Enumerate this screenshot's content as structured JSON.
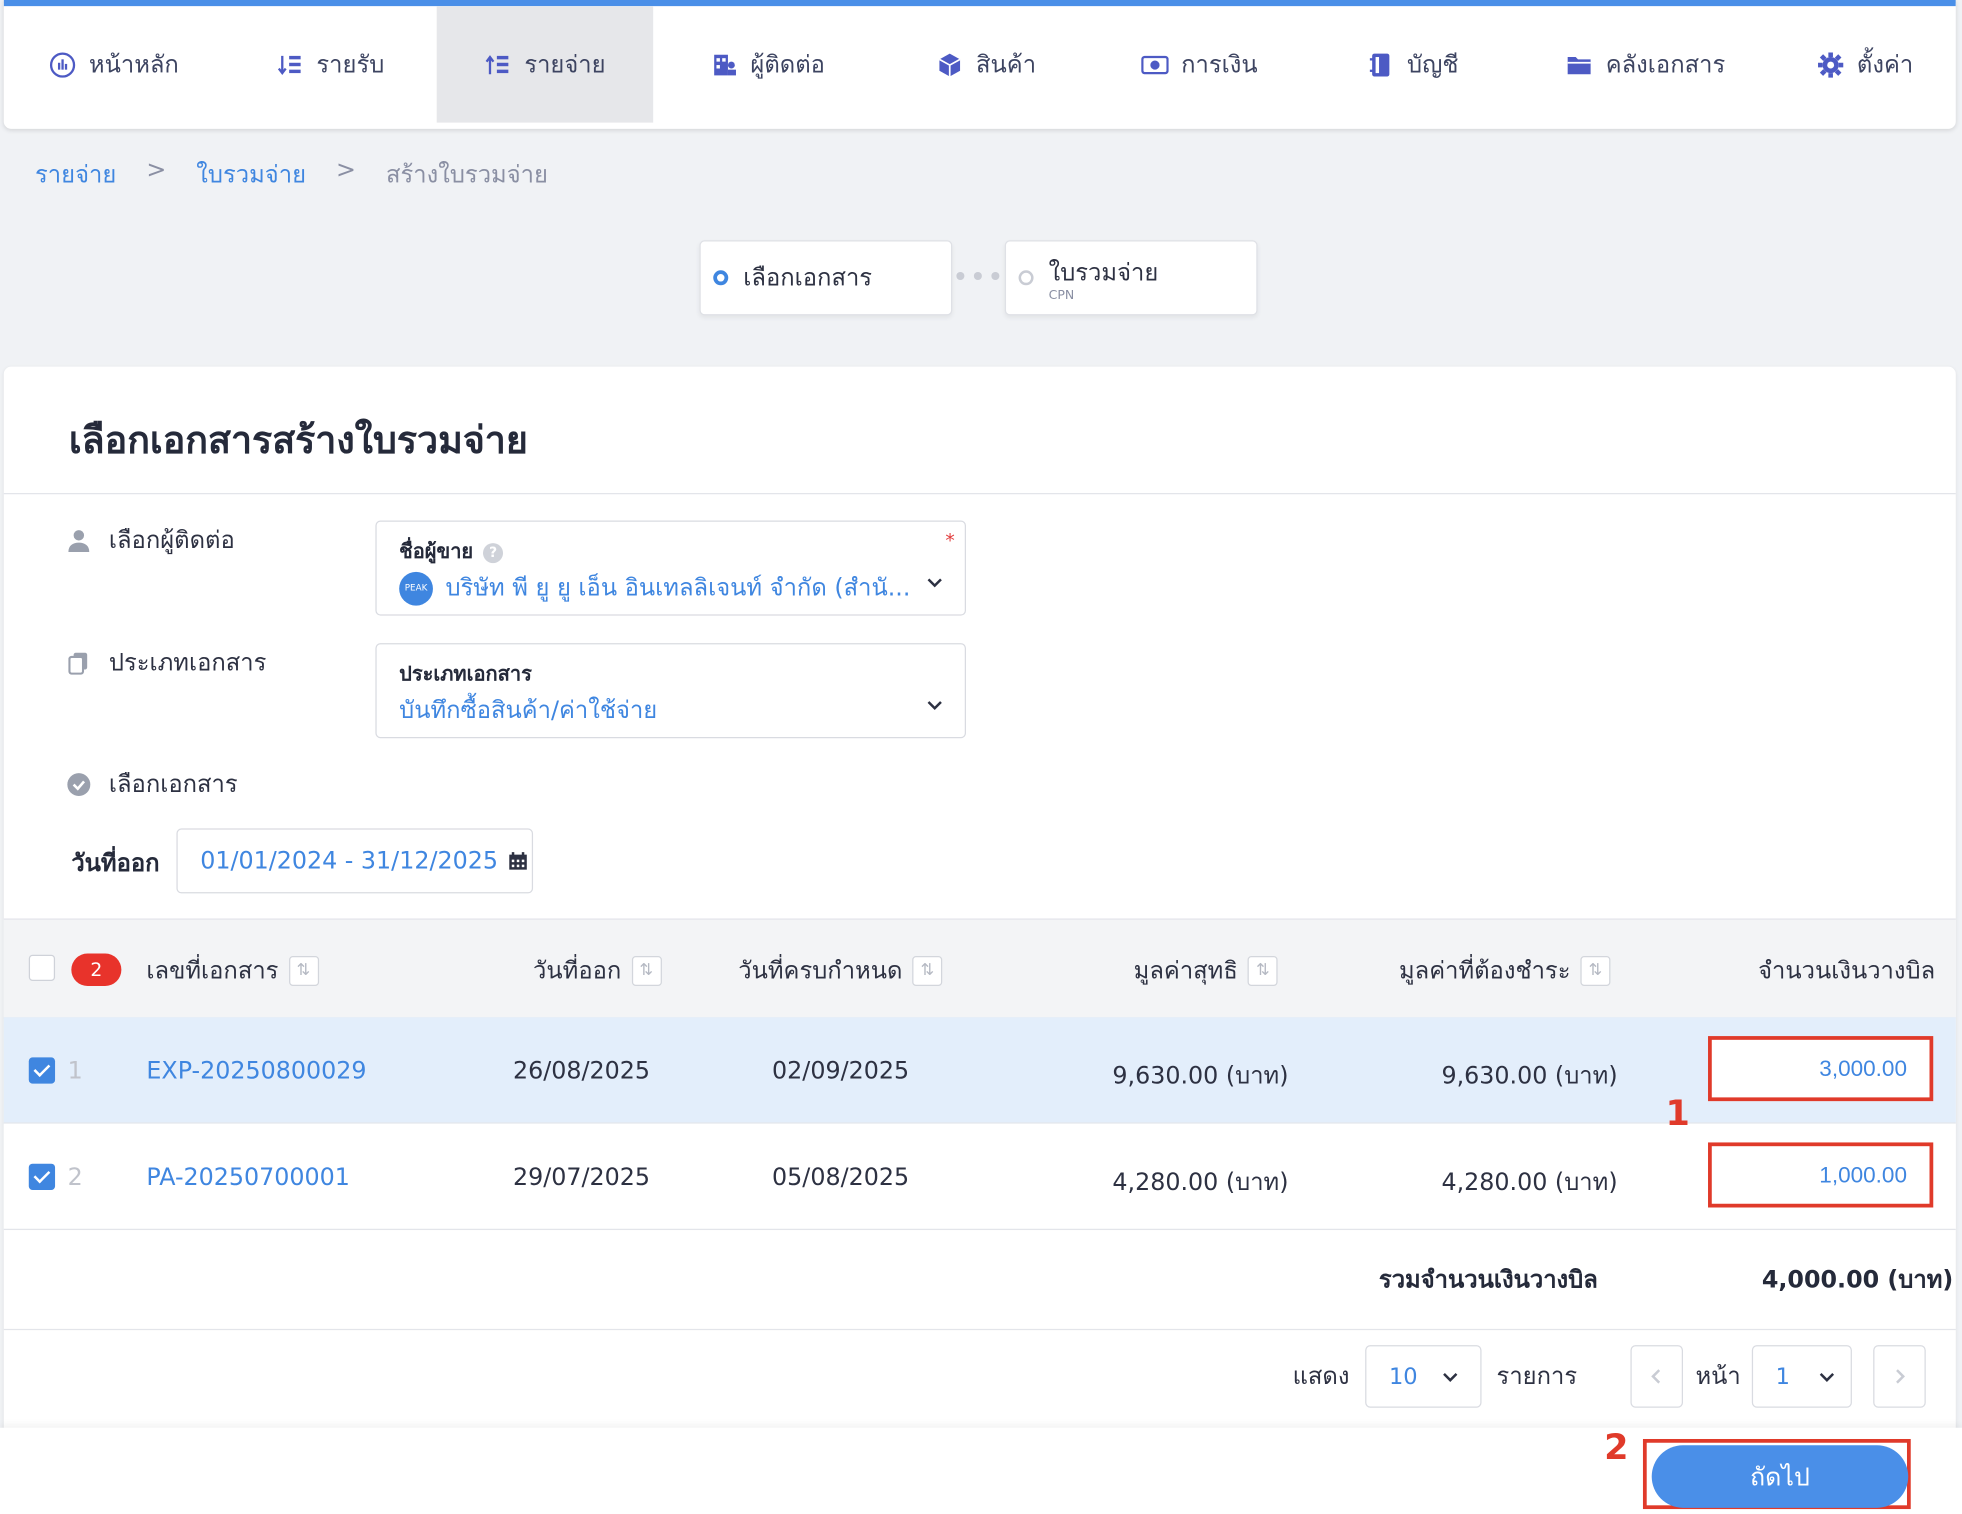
{
  "nav": {
    "items": [
      {
        "label": "หน้าหลัก",
        "icon": "dashboard-icon"
      },
      {
        "label": "รายรับ",
        "icon": "income-icon"
      },
      {
        "label": "รายจ่าย",
        "icon": "expense-icon",
        "active": true
      },
      {
        "label": "ผู้ติดต่อ",
        "icon": "contacts-icon"
      },
      {
        "label": "สินค้า",
        "icon": "box-icon"
      },
      {
        "label": "การเงิน",
        "icon": "money-icon"
      },
      {
        "label": "บัญชี",
        "icon": "ledger-icon"
      },
      {
        "label": "คลังเอกสาร",
        "icon": "folder-icon"
      },
      {
        "label": "ตั้งค่า",
        "icon": "gear-icon"
      }
    ]
  },
  "breadcrumb": {
    "item1": "รายจ่าย",
    "item2": "ใบรวมจ่าย",
    "item3": "สร้างใบรวมจ่าย",
    "sep": ">"
  },
  "stepper": {
    "step1": "เลือกเอกสาร",
    "step2": "ใบรวมจ่าย",
    "step2_sub": "CPN"
  },
  "form": {
    "title": "เลือกเอกสารสร้างใบรวมจ่าย",
    "contact_label": "เลือกผู้ติดต่อ",
    "vendor_caption": "ชื่อผู้ขาย",
    "vendor_required": "*",
    "vendor_value": "บริษัท พี ยู ยู เอ็น อินเทลลิเจนท์ จำกัด (สำนั...",
    "peak_logo": "PEAK",
    "doctype_label": "ประเภทเอกสาร",
    "doctype_caption": "ประเภทเอกสาร",
    "doctype_value": "บันทึกซื้อสินค้า/ค่าใช้จ่าย",
    "selectdoc_label": "เลือกเอกสาร",
    "date_label": "วันที่ออก",
    "date_range": "01/01/2024 - 31/12/2025"
  },
  "table": {
    "selected_count": "2",
    "headers": {
      "docno": "เลขที่เอกสาร",
      "issue": "วันที่ออก",
      "due": "วันที่ครบกำหนด",
      "net": "มูลค่าสุทธิ",
      "payable": "มูลค่าที่ต้องชำระ",
      "billing": "จำนวนเงินวางบิล"
    },
    "rows": [
      {
        "idx": "1",
        "docno": "EXP-20250800029",
        "issue": "26/08/2025",
        "due": "02/09/2025",
        "net": "9,630.00 (บาท)",
        "payable": "9,630.00 (บาท)",
        "billing": "3,000.00"
      },
      {
        "idx": "2",
        "docno": "PA-20250700001",
        "issue": "29/07/2025",
        "due": "05/08/2025",
        "net": "4,280.00 (บาท)",
        "payable": "4,280.00 (บาท)",
        "billing": "1,000.00"
      }
    ],
    "total_label": "รวมจำนวนเงินวางบิล",
    "total_value": "4,000.00 (บาท)"
  },
  "pagination": {
    "show_label": "แสดง",
    "per_page": "10",
    "items_label": "รายการ",
    "page_label": "หน้า",
    "page": "1"
  },
  "annotations": {
    "one": "1",
    "two": "2"
  },
  "actions": {
    "next": "ถัดไป"
  },
  "colors": {
    "accent": "#3f86e0",
    "annotation": "#e03a2a",
    "badge": "#e8332b"
  }
}
